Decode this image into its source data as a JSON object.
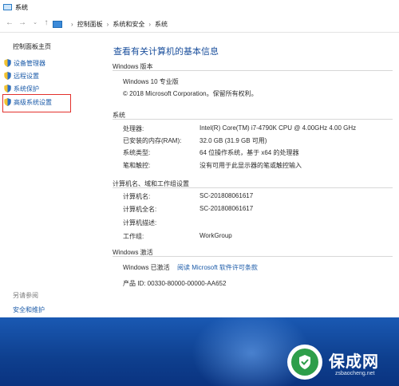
{
  "window": {
    "title": "系统"
  },
  "breadcrumb": [
    "控制面板",
    "系统和安全",
    "系统"
  ],
  "sidebar": {
    "home": "控制面板主页",
    "items": [
      {
        "label": "设备管理器"
      },
      {
        "label": "远程设置"
      },
      {
        "label": "系统保护"
      },
      {
        "label": "高级系统设置"
      }
    ],
    "see_also": "另请参阅",
    "security": "安全和维护"
  },
  "main": {
    "title": "查看有关计算机的基本信息",
    "windows_edition": {
      "header": "Windows 版本",
      "name": "Windows 10 专业版",
      "copyright": "© 2018 Microsoft Corporation。保留所有权利。"
    },
    "system": {
      "header": "系统",
      "rows": [
        {
          "label": "处理器:",
          "value": "Intel(R) Core(TM) i7-4790K CPU @ 4.00GHz   4.00 GHz"
        },
        {
          "label": "已安装的内存(RAM):",
          "value": "32.0 GB (31.9 GB 可用)"
        },
        {
          "label": "系统类型:",
          "value": "64 位操作系统，基于 x64 的处理器"
        },
        {
          "label": "笔和触控:",
          "value": "没有可用于此显示器的笔或触控输入"
        }
      ]
    },
    "computer": {
      "header": "计算机名、域和工作组设置",
      "rows": [
        {
          "label": "计算机名:",
          "value": "SC-201808061617"
        },
        {
          "label": "计算机全名:",
          "value": "SC-201808061617"
        },
        {
          "label": "计算机描述:",
          "value": ""
        },
        {
          "label": "工作组:",
          "value": "WorkGroup"
        }
      ]
    },
    "activation": {
      "header": "Windows 激活",
      "status": "Windows 已激活",
      "license_link": "阅读 Microsoft 软件许可条款",
      "product_id": "产品 ID: 00330-80000-00000-AA652"
    }
  },
  "watermark": {
    "brand": "保成网",
    "url": "zsbaocheng.net"
  },
  "colors": {
    "link": "#1a5aa8",
    "title": "#1a4f9c",
    "highlight": "#e2312c",
    "banner": "#1a59b3",
    "logo_green": "#2e9e4a"
  }
}
